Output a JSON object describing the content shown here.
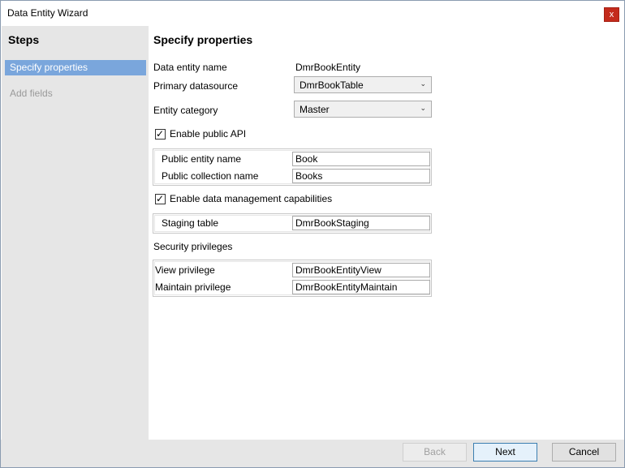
{
  "window": {
    "title": "Data Entity Wizard",
    "close_glyph": "x"
  },
  "sidebar": {
    "title": "Steps",
    "steps": [
      {
        "label": "Specify properties"
      },
      {
        "label": "Add fields"
      }
    ]
  },
  "main": {
    "heading": "Specify properties",
    "entity_name_label": "Data entity name",
    "entity_name_value": "DmrBookEntity",
    "primary_datasource_label": "Primary datasource",
    "primary_datasource_value": "DmrBookTable",
    "entity_category_label": "Entity category",
    "entity_category_value": "Master",
    "enable_public_api_label": "Enable public API",
    "enable_public_api_checked": true,
    "public_entity_name_label": "Public entity name",
    "public_entity_name_value": "Book",
    "public_collection_name_label": "Public collection name",
    "public_collection_name_value": "Books",
    "enable_dm_label": "Enable data management capabilities",
    "enable_dm_checked": true,
    "staging_table_label": "Staging table",
    "staging_table_value": "DmrBookStaging",
    "security_privileges_label": "Security privileges",
    "view_privilege_label": "View privilege",
    "view_privilege_value": "DmrBookEntityView",
    "maintain_privilege_label": "Maintain privilege",
    "maintain_privilege_value": "DmrBookEntityMaintain"
  },
  "footer": {
    "back_label": "Back",
    "next_label": "Next",
    "cancel_label": "Cancel"
  },
  "icons": {
    "close": "close-icon",
    "dropdown": "chevron-down-icon",
    "check": "checkmark-icon"
  },
  "colors": {
    "accent": "#7aa6dc",
    "close_button": "#c42b1c",
    "sidebar_bg": "#e6e6e6"
  }
}
